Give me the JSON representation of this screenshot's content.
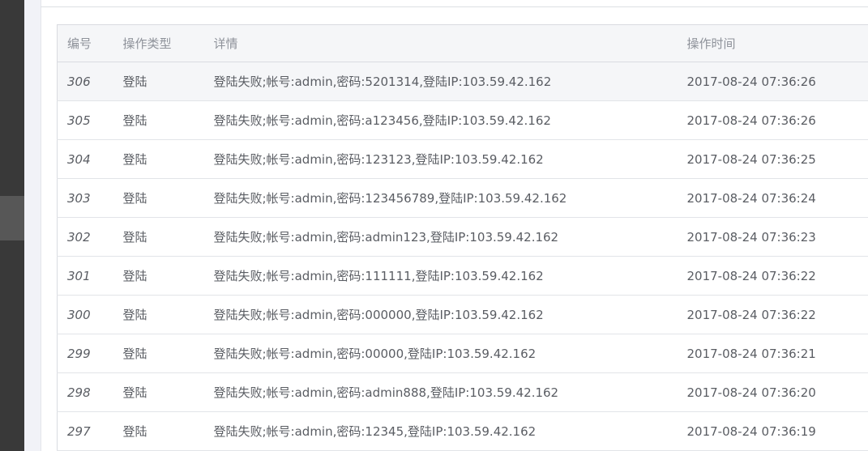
{
  "table": {
    "headers": {
      "id": "编号",
      "type": "操作类型",
      "detail": "详情",
      "time": "操作时间"
    },
    "rows": [
      {
        "id": "306",
        "type": "登陆",
        "detail": "登陆失败;帐号:admin,密码:5201314,登陆IP:103.59.42.162",
        "time": "2017-08-24 07:36:26"
      },
      {
        "id": "305",
        "type": "登陆",
        "detail": "登陆失败;帐号:admin,密码:a123456,登陆IP:103.59.42.162",
        "time": "2017-08-24 07:36:26"
      },
      {
        "id": "304",
        "type": "登陆",
        "detail": "登陆失败;帐号:admin,密码:123123,登陆IP:103.59.42.162",
        "time": "2017-08-24 07:36:25"
      },
      {
        "id": "303",
        "type": "登陆",
        "detail": "登陆失败;帐号:admin,密码:123456789,登陆IP:103.59.42.162",
        "time": "2017-08-24 07:36:24"
      },
      {
        "id": "302",
        "type": "登陆",
        "detail": "登陆失败;帐号:admin,密码:admin123,登陆IP:103.59.42.162",
        "time": "2017-08-24 07:36:23"
      },
      {
        "id": "301",
        "type": "登陆",
        "detail": "登陆失败;帐号:admin,密码:111111,登陆IP:103.59.42.162",
        "time": "2017-08-24 07:36:22"
      },
      {
        "id": "300",
        "type": "登陆",
        "detail": "登陆失败;帐号:admin,密码:000000,登陆IP:103.59.42.162",
        "time": "2017-08-24 07:36:22"
      },
      {
        "id": "299",
        "type": "登陆",
        "detail": "登陆失败;帐号:admin,密码:00000,登陆IP:103.59.42.162",
        "time": "2017-08-24 07:36:21"
      },
      {
        "id": "298",
        "type": "登陆",
        "detail": "登陆失败;帐号:admin,密码:admin888,登陆IP:103.59.42.162",
        "time": "2017-08-24 07:36:20"
      },
      {
        "id": "297",
        "type": "登陆",
        "detail": "登陆失败;帐号:admin,密码:12345,登陆IP:103.59.42.162",
        "time": "2017-08-24 07:36:19"
      }
    ]
  }
}
